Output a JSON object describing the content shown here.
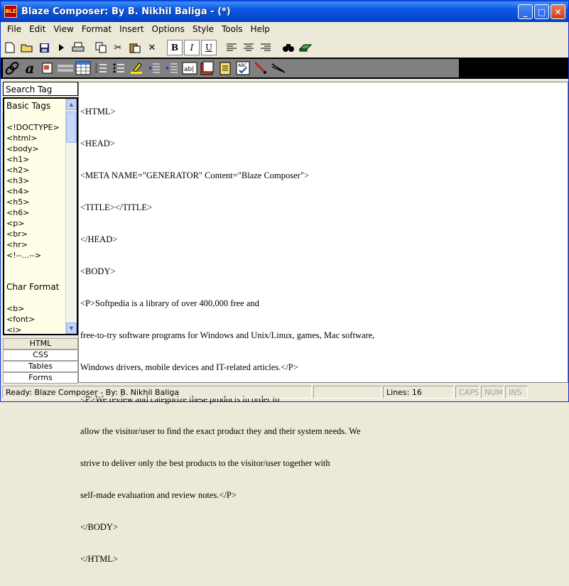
{
  "window": {
    "title": "Blaze Composer: By B. Nikhil Baliga - (*)",
    "icon_text": "BLZ",
    "minimize": "_",
    "maximize": "□",
    "close": "✕"
  },
  "menu": [
    "File",
    "Edit",
    "View",
    "Format",
    "Insert",
    "Options",
    "Style",
    "Tools",
    "Help"
  ],
  "toolbar": {
    "bold": "B",
    "italic": "I",
    "underline": "U"
  },
  "search": {
    "label": "Search Tag"
  },
  "tag_panel": {
    "sections": [
      {
        "heading": "Basic Tags",
        "items": [
          "<!DOCTYPE>",
          "<html>",
          "<body>",
          "<h1>",
          "<h2>",
          "<h3>",
          "<h4>",
          "<h5>",
          "<h6>",
          "<p>",
          "<br>",
          "<hr>",
          "<!--...-->"
        ]
      },
      {
        "heading": "Char Format",
        "items": [
          "<b>",
          "<font>",
          "<i>"
        ]
      }
    ]
  },
  "tabs": [
    "HTML",
    "CSS",
    "Tables",
    "Forms"
  ],
  "editor": {
    "lines": [
      "<HTML>",
      "<HEAD>",
      "<META NAME=\"GENERATOR\" Content=\"Blaze Composer\">",
      "<TITLE></TITLE>",
      "</HEAD>",
      "<BODY>",
      "<P>Softpedia is a library of over 400,000 free and",
      "free-to-try software programs for Windows and Unix/Linux, games, Mac software,",
      "Windows drivers, mobile devices and IT-related articles.</P>",
      "<P>We review and categorize these products in order to",
      "allow the visitor/user to find the exact product they and their system needs. We",
      "strive to deliver only the best products to the visitor/user together with",
      "self-made evaluation and review notes.</P>",
      "</BODY>",
      "</HTML>"
    ]
  },
  "status": {
    "message": "Ready: Blaze Composer - By: B. Nikhil Baliga",
    "lines": "Lines:  16",
    "caps": "CAPS",
    "num": "NUM",
    "ins": "INS"
  }
}
